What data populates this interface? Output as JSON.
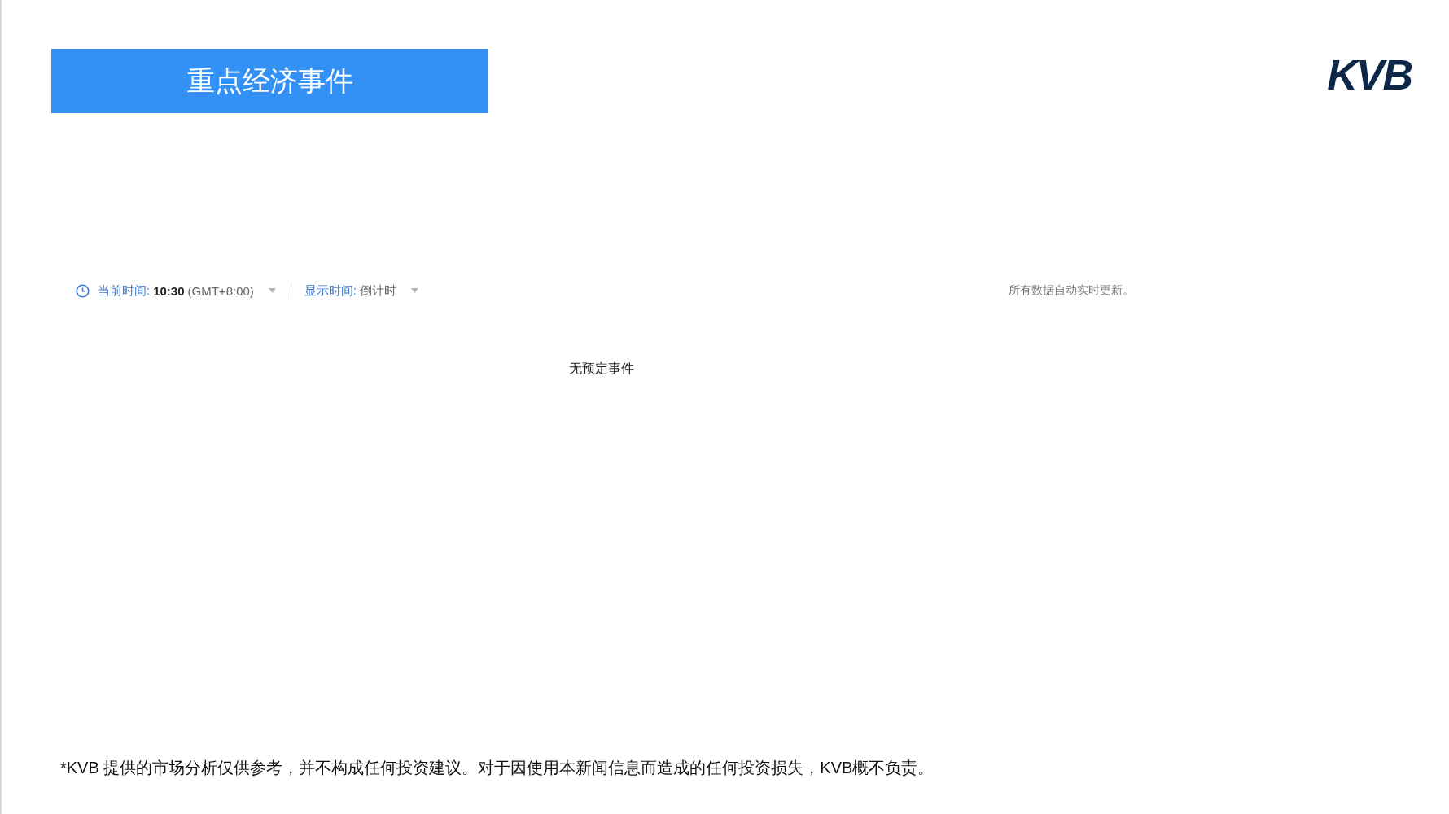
{
  "header": {
    "title": "重点经济事件",
    "logo": "KVB"
  },
  "toolbar": {
    "current_time_label": "当前时间:",
    "current_time": "10:30",
    "timezone": "(GMT+8:00)",
    "display_label": "显示时间:",
    "display_value": "倒计时",
    "update_note": "所有数据自动实时更新。"
  },
  "empty_message": "无预定事件",
  "disclaimer": "*KVB 提供的市场分析仅供参考，并不构成任何投资建议。对于因使用本新闻信息而造成的任何投资损失，KVB概不负责。"
}
